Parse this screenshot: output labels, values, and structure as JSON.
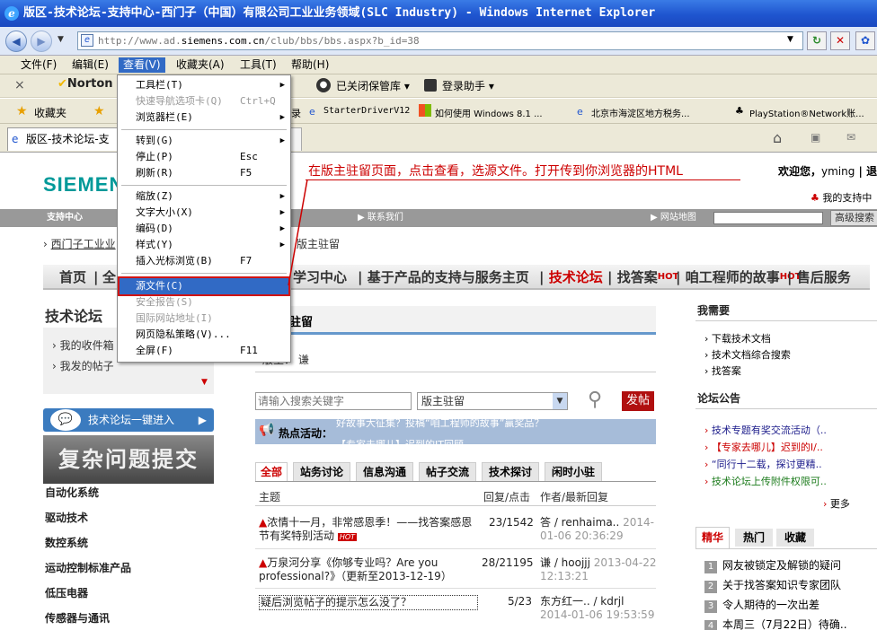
{
  "window": {
    "title": "版区-技术论坛-支持中心-西门子（中国）有限公司工业业务领域(SLC Industry) - Windows Internet Explorer"
  },
  "address": {
    "url_prefix": "http://www.ad.",
    "url_domain": "siemens.com.cn",
    "url_path": "/club/bbs/bbs.aspx?b_id=38"
  },
  "menubar": [
    "文件(F)",
    "编辑(E)",
    "查看(V)",
    "收藏夹(A)",
    "工具(T)",
    "帮助(H)"
  ],
  "toolbar": {
    "norton": "Norton",
    "popup_blocker": "已关闭保管库",
    "login_helper": "登录助手"
  },
  "favorites": {
    "label": "收藏夹",
    "items": [
      "录",
      "StarterDriverV12",
      "如何使用 Windows 8.1 ...",
      "北京市海淀区地方税务...",
      "PlayStation®Network账..."
    ]
  },
  "tab": {
    "label": "版区-技术论坛-支"
  },
  "view_menu": {
    "items": [
      {
        "label": "工具栏(T)",
        "shortcut": "",
        "submenu": true,
        "disabled": false
      },
      {
        "label": "快速导航选项卡(Q)",
        "shortcut": "Ctrl+Q",
        "submenu": false,
        "disabled": true
      },
      {
        "label": "浏览器栏(E)",
        "shortcut": "",
        "submenu": true,
        "disabled": false
      },
      {
        "label": "转到(G)",
        "shortcut": "",
        "submenu": true,
        "disabled": false
      },
      {
        "label": "停止(P)",
        "shortcut": "Esc",
        "submenu": false,
        "disabled": false
      },
      {
        "label": "刷新(R)",
        "shortcut": "F5",
        "submenu": false,
        "disabled": false
      },
      {
        "label": "缩放(Z)",
        "shortcut": "",
        "submenu": true,
        "disabled": false
      },
      {
        "label": "文字大小(X)",
        "shortcut": "",
        "submenu": true,
        "disabled": false
      },
      {
        "label": "编码(D)",
        "shortcut": "",
        "submenu": true,
        "disabled": false
      },
      {
        "label": "样式(Y)",
        "shortcut": "",
        "submenu": true,
        "disabled": false
      },
      {
        "label": "插入光标浏览(B)",
        "shortcut": "F7",
        "submenu": false,
        "disabled": false
      },
      {
        "label": "源文件(C)",
        "shortcut": "",
        "submenu": false,
        "disabled": false
      },
      {
        "label": "安全报告(S)",
        "shortcut": "",
        "submenu": false,
        "disabled": true
      },
      {
        "label": "国际网站地址(I)",
        "shortcut": "",
        "submenu": false,
        "disabled": true
      },
      {
        "label": "网页隐私策略(V)...",
        "shortcut": "",
        "submenu": false,
        "disabled": false
      },
      {
        "label": "全屏(F)",
        "shortcut": "F11",
        "submenu": false,
        "disabled": false
      }
    ]
  },
  "annotation": "在版主驻留页面，点击查看，选源文件。打开传到你浏览器的HTML",
  "page": {
    "logo": "SIEMENS",
    "welcome": "欢迎您，",
    "user": "yming",
    "support_link": "我的支持中",
    "graybar": {
      "support": "支持中心",
      "contact": "联系我们",
      "sitemap": "网站地图",
      "search_btn": "高级搜索"
    },
    "breadcrumb": "西门子工业业",
    "breadcrumb_tail": "版主驻留",
    "mainnav": {
      "home": "首页",
      "all": "全",
      "learning": "学习中心",
      "product_support": "基于产品的支持与服务主页",
      "forum": "技术论坛",
      "find_answer": "找答案",
      "engineer": "咱工程师的故事",
      "after_sales": "售后服务",
      "hot": "HOT"
    },
    "sidebar": {
      "title": "技术论坛",
      "my_collection": "我的收件箱",
      "my_posts": "我发的帖子",
      "enter": "技术论坛一键进入",
      "banner": "复杂问题提交",
      "categories": [
        "自动化系统",
        "驱动技术",
        "数控系统",
        "运动控制标准产品",
        "低压电器",
        "传感器与通讯"
      ]
    },
    "board": {
      "title": "驻留",
      "moderator_label": "版主：",
      "moderator": "谦"
    },
    "search": {
      "placeholder": "请输入搜索关键字",
      "select": "版主驻留",
      "post_btn": "发帖"
    },
    "hot_activity": {
      "label": "热点活动：",
      "line1": "好故事大征集？投稿“咱工程师的故事”赢奖品？",
      "line2": "【专家去哪儿】迟到的IT回顾"
    },
    "tabs": [
      "全部",
      "站务讨论",
      "信息沟通",
      "帖子交流",
      "技术探讨",
      "闲时小驻"
    ],
    "table": {
      "headers": {
        "topic": "主题",
        "reply": "回复/点击",
        "author": "作者/最新回复"
      },
      "rows": [
        {
          "title": "浓情十一月，非常感恩季！——找答案感恩节有奖特别活动",
          "count": "23/1542",
          "author": "答 / renhaima..",
          "date": "2014-01-06 20:36:29",
          "badge": "HOT"
        },
        {
          "title": "万泉河分享《你够专业吗？Are you professional?》（更新至2013-12-19）",
          "count": "28/21195",
          "author": "谦 / hoojjj",
          "date": "2013-04-22 12:13:21",
          "badge": ""
        },
        {
          "title": "疑后浏览帖子的提示怎么没了？",
          "count": "5/23",
          "author": "东方红一.. / kdrjl",
          "date": "2014-01-06 19:53:59",
          "badge": ""
        }
      ]
    },
    "right": {
      "need_title": "我需要",
      "need_links": [
        "下载技术文档",
        "技术文档综合搜索",
        "找答案"
      ],
      "notice_title": "论坛公告",
      "notices": [
        "技术专题有奖交流活动（..",
        "【专家去哪儿】迟到的I/..",
        "“同行十二载，探讨更精..",
        "技术论坛上传附件权限可.."
      ],
      "more": "更多",
      "tabs": [
        "精华",
        "热门",
        "收藏"
      ],
      "list": [
        "网友被锁定及解锁的疑问",
        "关于找答案知识专家团队",
        "令人期待的一次出差",
        "本周三（7月22日）待确.."
      ]
    }
  }
}
